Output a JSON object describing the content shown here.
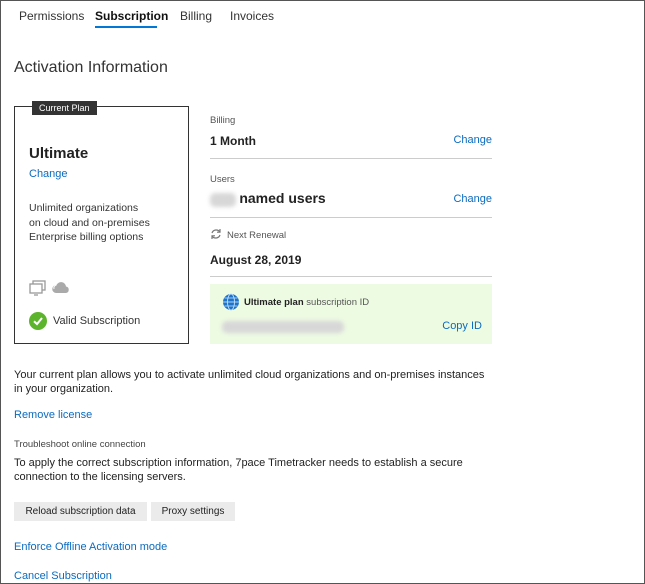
{
  "tabs": [
    {
      "label": "Permissions",
      "active": false
    },
    {
      "label": "Subscription",
      "active": true
    },
    {
      "label": "Billing",
      "active": false
    },
    {
      "label": "Invoices",
      "active": false
    }
  ],
  "section_title": "Activation Information",
  "plan_card": {
    "tag": "Current Plan",
    "name": "Ultimate",
    "change_label": "Change",
    "description": [
      "Unlimited organizations",
      "on cloud and on-premises",
      "Enterprise billing options"
    ],
    "icons": [
      "server-icon",
      "cloud-icon"
    ],
    "status_label": "Valid Subscription",
    "status_color": "#5cb42c"
  },
  "billing": {
    "label": "Billing",
    "value": "1 Month",
    "change_label": "Change"
  },
  "users": {
    "label": "Users",
    "value_suffix": "named users",
    "change_label": "Change"
  },
  "renewal": {
    "label": "Next Renewal",
    "value": "August 28, 2019"
  },
  "subscription_id": {
    "plan_label": "Ultimate plan",
    "suffix": "subscription ID",
    "copy_label": "Copy ID",
    "background": "#eefbe3"
  },
  "plan_note": "Your current plan allows you to activate unlimited cloud organizations and on-premises instances in your organization.",
  "remove_license": "Remove license",
  "troubleshoot_heading": "Troubleshoot online connection",
  "troubleshoot_text": "To apply the correct subscription information, 7pace Timetracker needs to establish a secure connection to the licensing servers.",
  "buttons": {
    "reload": "Reload subscription data",
    "proxy": "Proxy settings"
  },
  "enforce_offline": "Enforce Offline Activation mode",
  "cancel_subscription": "Cancel Subscription",
  "accent_color": "#0b6bbf"
}
